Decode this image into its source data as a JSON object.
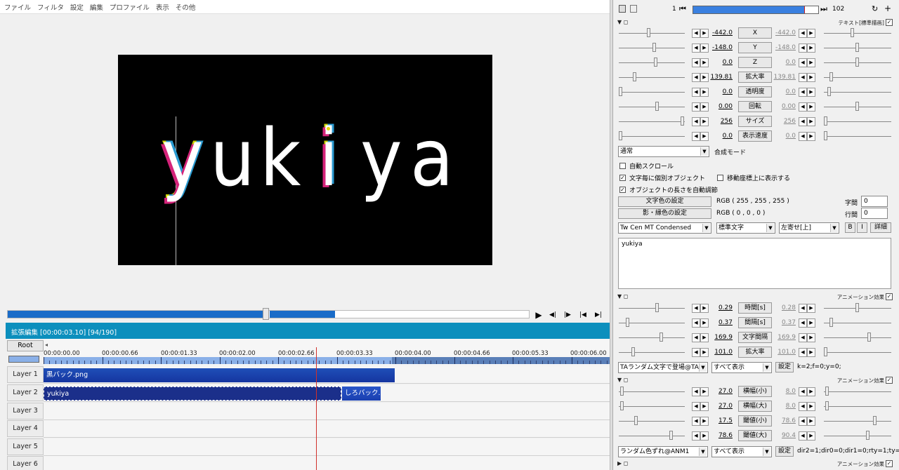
{
  "menu": [
    "ファイル",
    "フィルタ",
    "設定",
    "編集",
    "プロファイル",
    "表示",
    "その他"
  ],
  "preview": {
    "letters": [
      "y",
      "u",
      "k",
      "i",
      "y",
      "a"
    ]
  },
  "playback": {
    "play_icon": "play-icon",
    "prev_frame_icon": "prev-frame-icon",
    "next_frame_icon": "next-frame-icon",
    "skip_start_icon": "skip-start-icon",
    "skip_end_icon": "skip-end-icon",
    "symbols": [
      "▶",
      "◀|",
      "|▶",
      "|◀",
      "▶|"
    ]
  },
  "timeline": {
    "header": "拡張編集 [00:00:03.10] [94/190]",
    "root": "Root",
    "ruler_arrow": "◂",
    "times": [
      "00:00:00.00",
      "00:00:00.66",
      "00:00:01.33",
      "00:00:02.00",
      "00:00:02.66",
      "00:00:03.33",
      "00:00:04.00",
      "00:00:04.66",
      "00:00:05.33",
      "00:00:06.00"
    ],
    "layers": [
      "Layer 1",
      "Layer 2",
      "Layer 3",
      "Layer 4",
      "Layer 5",
      "Layer 6"
    ],
    "clips": {
      "layer1": "黒バック.png",
      "layer2a": "yukiya",
      "layer2b": "しろバック.png"
    }
  },
  "panel": {
    "frame_start": "1",
    "frame_end": "102",
    "frame_progress": 0.89,
    "text_section": "テキスト[標準描画]",
    "params": [
      {
        "l": "-442.0",
        "name": "X",
        "r": "-442.0"
      },
      {
        "l": "-148.0",
        "name": "Y",
        "r": "-148.0"
      },
      {
        "l": "0.0",
        "name": "Z",
        "r": "0.0"
      },
      {
        "l": "139.81",
        "name": "拡大率",
        "r": "139.81"
      },
      {
        "l": "0.0",
        "name": "透明度",
        "r": "0.0"
      },
      {
        "l": "0.00",
        "name": "回転",
        "r": "0.00"
      },
      {
        "l": "256",
        "name": "サイズ",
        "r": "256"
      },
      {
        "l": "0.0",
        "name": "表示速度",
        "r": "0.0"
      }
    ],
    "blend_value": "通常",
    "blend_label": "合成モード",
    "cb_autoscroll": "自動スクロール",
    "cb_individual": "文字毎に個別オブジェクト",
    "cb_showcoord": "移動座標上に表示する",
    "cb_autolength": "オブジェクトの長さを自動調節",
    "color_btn": "文字色の設定",
    "color_val": "RGB ( 255 , 255 , 255 )",
    "shadow_btn": "影・縁色の設定",
    "shadow_val": "RGB ( 0 , 0 , 0 )",
    "char_spacing_label": "字間",
    "char_spacing": "0",
    "line_spacing_label": "行間",
    "line_spacing": "0",
    "font": "Tw Cen MT Condensed",
    "style": "標準文字",
    "align": "左寄せ[上]",
    "bold": "B",
    "italic": "I",
    "detail": "詳細",
    "text": "yukiya",
    "anim_title": "アニメーション効果",
    "anim1": [
      {
        "l": "0.29",
        "name": "時間[s]",
        "r": "0.28"
      },
      {
        "l": "0.37",
        "name": "間隔[s]",
        "r": "0.37"
      },
      {
        "l": "169.9",
        "name": "文字間隔",
        "r": "169.9"
      },
      {
        "l": "101.0",
        "name": "拡大率",
        "r": "101.0"
      }
    ],
    "anim1_select": "TAランダム文字で登場@TA",
    "anim1_show": "すべて表示",
    "anim1_set": "設定",
    "anim1_param": "k=2;f=0;y=0;",
    "anim2": [
      {
        "l": "27.0",
        "name": "横幅(小)",
        "r": "8.0"
      },
      {
        "l": "27.0",
        "name": "横幅(大)",
        "r": "8.0"
      },
      {
        "l": "17.5",
        "name": "閾値(小)",
        "r": "78.6"
      },
      {
        "l": "78.6",
        "name": "閾値(大)",
        "r": "90.4"
      }
    ],
    "anim2_select": "ランダム色ずれ@ANM1",
    "anim2_show": "すべて表示",
    "anim2_set": "設定",
    "anim2_param": "dir2=1;dir0=0;dir1=0;rty=1;ty=0;",
    "check": "✓"
  }
}
